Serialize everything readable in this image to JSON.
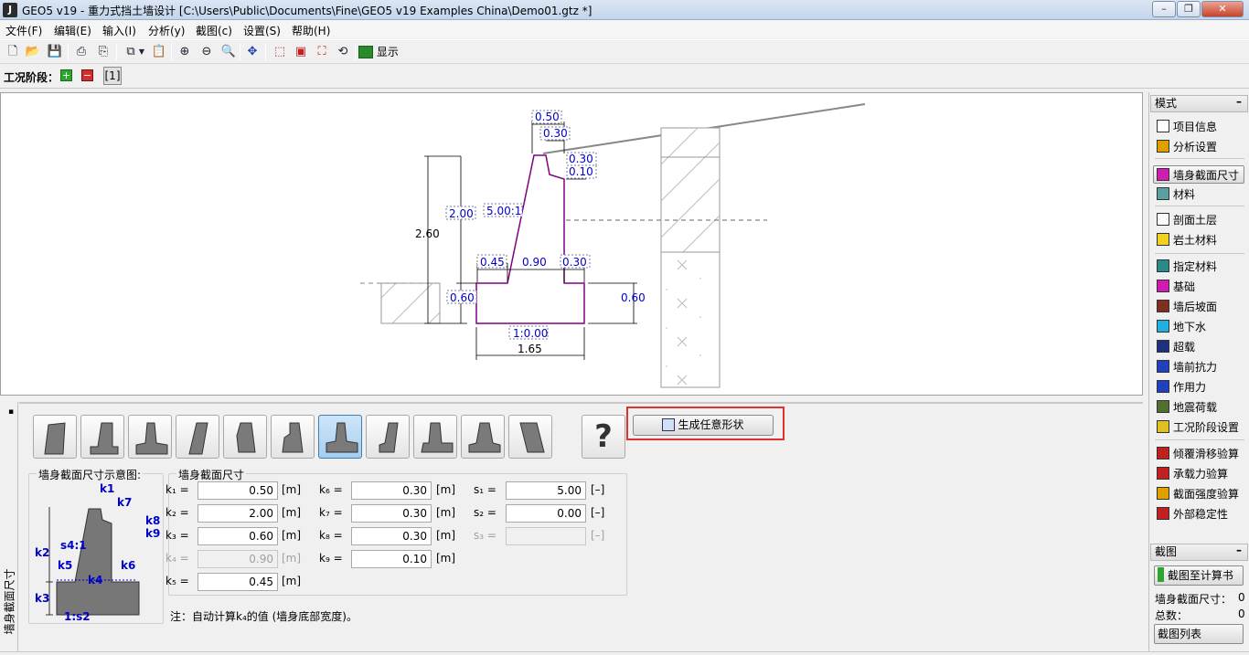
{
  "window": {
    "title": "GEO5 v19 - 重力式挡土墙设计 [C:\\Users\\Public\\Documents\\Fine\\GEO5 v19 Examples China\\Demo01.gtz *]",
    "app_icon_letter": "J"
  },
  "menu": [
    "文件(F)",
    "编辑(E)",
    "输入(I)",
    "分析(y)",
    "截图(c)",
    "设置(S)",
    "帮助(H)"
  ],
  "toolbar": {
    "display_label": "显示"
  },
  "stages": {
    "label": "工况阶段：",
    "current": "[1]"
  },
  "drawing": {
    "dims": {
      "top_width": "0.50",
      "top_inner": "0.30",
      "k8": "0.30",
      "k9": "0.10",
      "height_k2": "2.00",
      "slope": "5.00:1",
      "total_height": "2.60",
      "k5": "0.45",
      "k4": "0.90",
      "k6": "0.30",
      "base_left": "0.60",
      "base_right": "0.60",
      "base_slope": "1:0.00",
      "base_width": "1.65"
    }
  },
  "right_panel": {
    "mode_header": "模式",
    "items": [
      {
        "label": "项目信息",
        "icon": "document-icon"
      },
      {
        "label": "分析设置",
        "icon": "gear-icon"
      },
      {
        "label": "墙身截面尺寸",
        "icon": "wall-profile-icon",
        "active": true
      },
      {
        "label": "材料",
        "icon": "material-icon"
      },
      {
        "label": "剖面土层",
        "icon": "soil-layer-icon"
      },
      {
        "label": "岩土材料",
        "icon": "soil-material-icon"
      },
      {
        "label": "指定材料",
        "icon": "assign-material-icon"
      },
      {
        "label": "基础",
        "icon": "foundation-icon"
      },
      {
        "label": "墙后坡面",
        "icon": "terrain-icon"
      },
      {
        "label": "地下水",
        "icon": "water-icon"
      },
      {
        "label": "超载",
        "icon": "surcharge-icon"
      },
      {
        "label": "墙前抗力",
        "icon": "resistance-icon"
      },
      {
        "label": "作用力",
        "icon": "force-icon"
      },
      {
        "label": "地震荷载",
        "icon": "earthquake-icon"
      },
      {
        "label": "工况阶段设置",
        "icon": "stage-settings-icon"
      },
      {
        "label": "倾覆滑移验算",
        "icon": "overturning-icon"
      },
      {
        "label": "承载力验算",
        "icon": "bearing-icon"
      },
      {
        "label": "截面强度验算",
        "icon": "section-check-icon"
      },
      {
        "label": "外部稳定性",
        "icon": "stability-icon"
      }
    ],
    "screenshot_header": "截图",
    "screenshot_button": "截图至计算书",
    "wall_count_label": "墙身截面尺寸：",
    "wall_count_value": "0",
    "total_label": "总数：",
    "total_value": "0",
    "list_button": "截图列表"
  },
  "bottom_panel": {
    "vertical_tab": "墙身截面尺寸",
    "generate_button": "生成任意形状",
    "help_label": "?",
    "diagram_title": "墙身截面尺寸示意图:",
    "fields_title": "墙身截面尺寸",
    "diagram_labels": {
      "k1": "k1",
      "k2": "k2",
      "k3": "k3",
      "k4": "k4",
      "k5": "k5",
      "k6": "k6",
      "k7": "k7",
      "k8": "k8",
      "k9": "k9",
      "s4": "s4:1",
      "s2": "1:s2"
    },
    "fields": {
      "k1": {
        "label": "k₁ =",
        "value": "0.50",
        "unit": "[m]"
      },
      "k2": {
        "label": "k₂ =",
        "value": "2.00",
        "unit": "[m]"
      },
      "k3": {
        "label": "k₃ =",
        "value": "0.60",
        "unit": "[m]"
      },
      "k4": {
        "label": "k₄ =",
        "value": "0.90",
        "unit": "[m]"
      },
      "k5": {
        "label": "k₅ =",
        "value": "0.45",
        "unit": "[m]"
      },
      "k6": {
        "label": "k₆ =",
        "value": "0.30",
        "unit": "[m]"
      },
      "k7": {
        "label": "k₇ =",
        "value": "0.30",
        "unit": "[m]"
      },
      "k8": {
        "label": "k₈ =",
        "value": "0.30",
        "unit": "[m]"
      },
      "k9": {
        "label": "k₉ =",
        "value": "0.10",
        "unit": "[m]"
      },
      "s1": {
        "label": "s₁ =",
        "value": "5.00",
        "unit": "[–]"
      },
      "s2": {
        "label": "s₂ =",
        "value": "0.00",
        "unit": "[–]"
      },
      "s3": {
        "label": "s₃ =",
        "value": "",
        "unit": "[–]"
      }
    },
    "note": "注：自动计算k₄的值 (墙身底部宽度)。"
  }
}
